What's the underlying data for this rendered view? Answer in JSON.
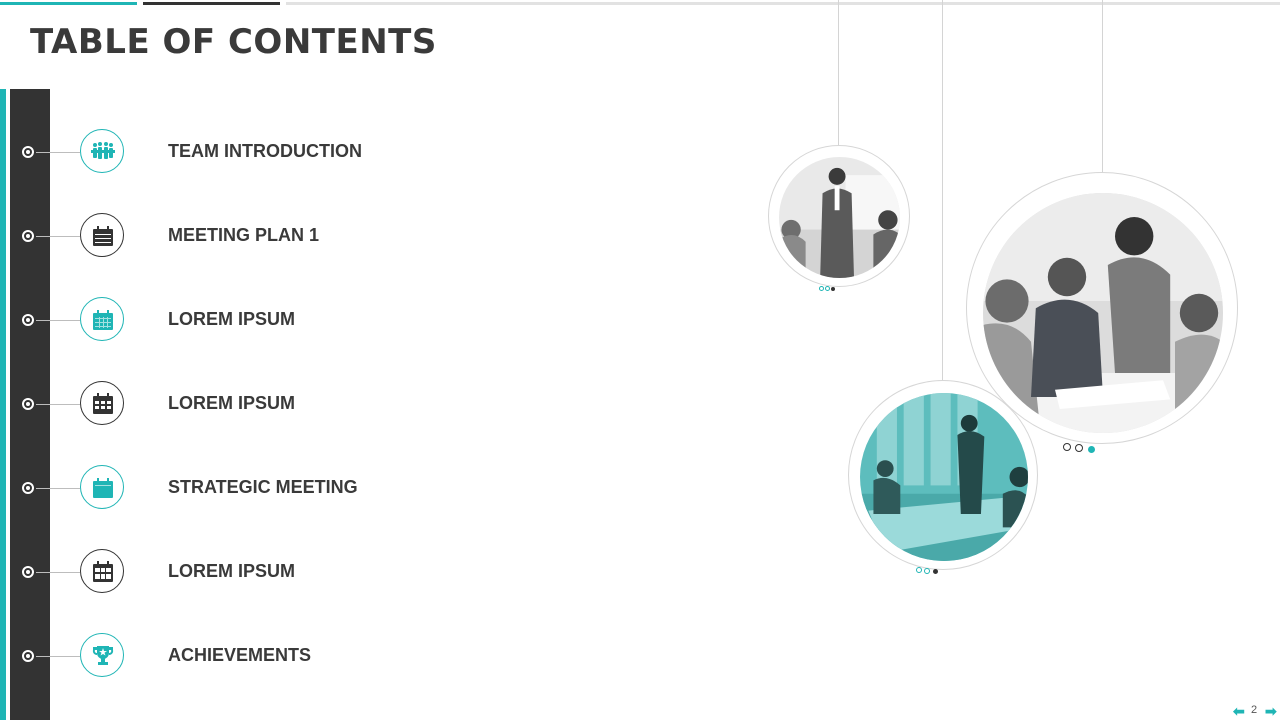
{
  "colors": {
    "accent": "#1fb5b5",
    "dark": "#333333",
    "text": "#3a3a3a"
  },
  "header": {
    "title": "TABLE OF CONTENTS"
  },
  "agenda": {
    "items": [
      {
        "label": "TEAM INTRODUCTION",
        "icon": "team-icon"
      },
      {
        "label": "MEETING PLAN 1",
        "icon": "calendar-icon"
      },
      {
        "label": "LOREM IPSUM",
        "icon": "calendar-icon"
      },
      {
        "label": "LOREM IPSUM",
        "icon": "calendar-grid-icon"
      },
      {
        "label": "STRATEGIC MEETING",
        "icon": "calendar-icon"
      },
      {
        "label": "LOREM IPSUM",
        "icon": "calendar-grid-icon"
      },
      {
        "label": "ACHIEVEMENTS",
        "icon": "trophy-icon"
      }
    ]
  },
  "photos": [
    {
      "subject": "presenter-photo"
    },
    {
      "subject": "team-collaboration-photo"
    },
    {
      "subject": "boardroom-meeting-photo"
    }
  ],
  "footer": {
    "page_number": "2",
    "prev_icon": "arrow-left-icon",
    "next_icon": "arrow-right-icon"
  }
}
